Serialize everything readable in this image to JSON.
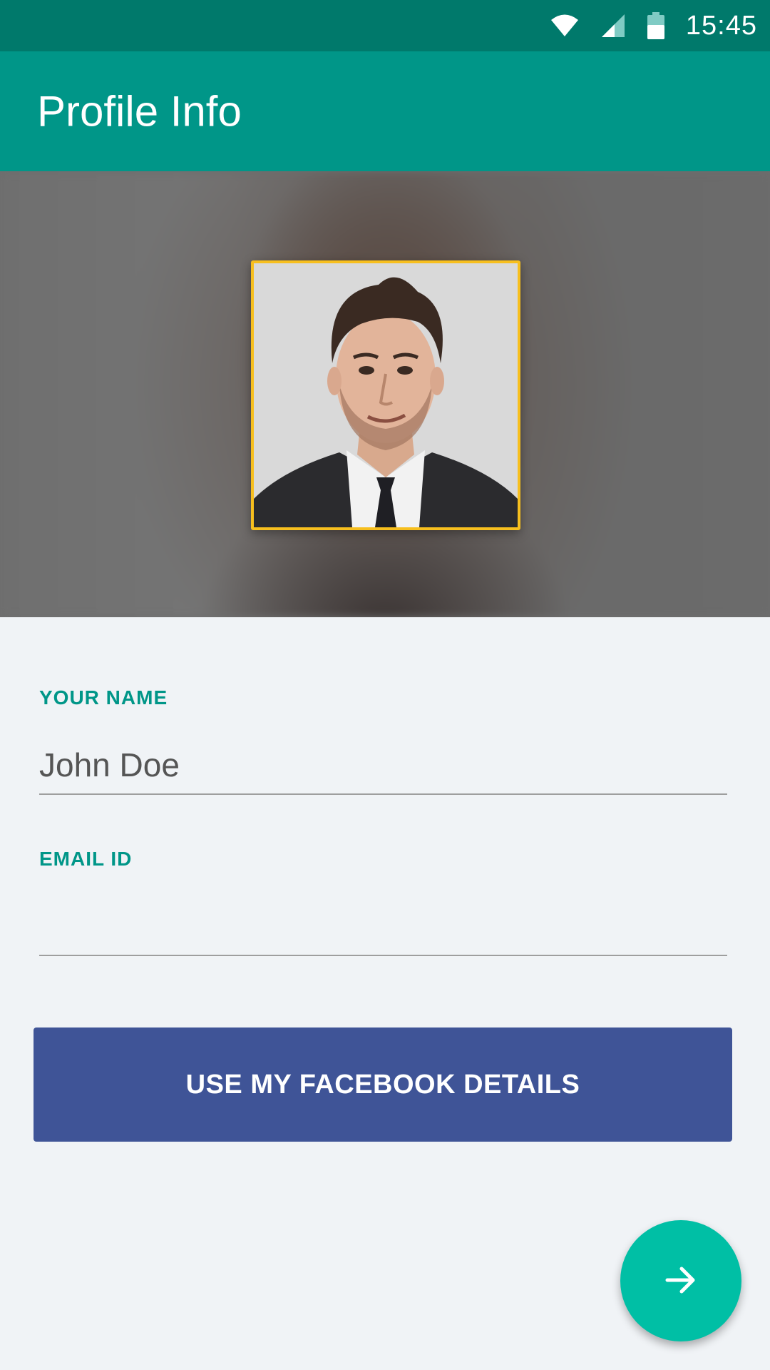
{
  "status_bar": {
    "time": "15:45",
    "icons": [
      "wifi-icon",
      "cell-signal-icon",
      "battery-icon"
    ]
  },
  "app_bar": {
    "title": "Profile Info",
    "color": "#009688"
  },
  "profile_photo": {
    "icon": "profile-photo",
    "frame_color": "#f7bf1e"
  },
  "form": {
    "name_label": "YOUR NAME",
    "name_value": "John Doe",
    "email_label": "EMAIL ID",
    "email_value": ""
  },
  "facebook_button": {
    "label": "USE MY FACEBOOK DETAILS",
    "color": "#3f5497"
  },
  "fab": {
    "icon": "arrow-right-icon",
    "color": "#00bfa5"
  }
}
